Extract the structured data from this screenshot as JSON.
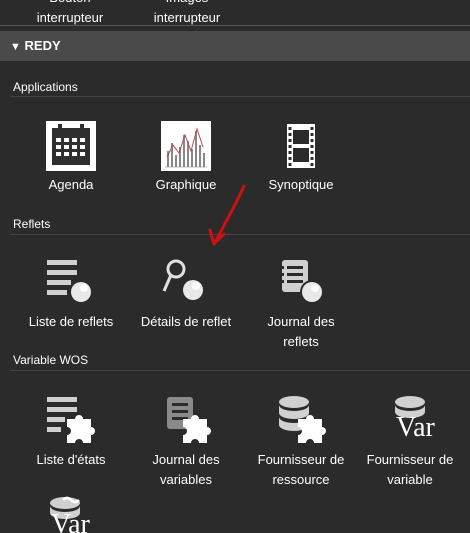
{
  "top_items": [
    {
      "line1": "Bouton",
      "line2": "interrupteur"
    },
    {
      "line1": "Images",
      "line2": "interrupteur"
    }
  ],
  "group": {
    "title": "REDY"
  },
  "sections": {
    "applications": {
      "title": "Applications",
      "items": [
        {
          "label": "Agenda"
        },
        {
          "label": "Graphique"
        },
        {
          "label": "Synoptique"
        }
      ]
    },
    "reflets": {
      "title": "Reflets",
      "items": [
        {
          "line1": "Liste de reflets",
          "line2": ""
        },
        {
          "line1": "Détails de reflet",
          "line2": ""
        },
        {
          "line1": "Journal des",
          "line2": "reflets"
        }
      ]
    },
    "variable_wos": {
      "title": "Variable WOS",
      "items": [
        {
          "line1": "Liste d'états",
          "line2": ""
        },
        {
          "line1": "Journal des",
          "line2": "variables"
        },
        {
          "line1": "Fournisseur de",
          "line2": "ressource"
        },
        {
          "line1": "Fournisseur de",
          "line2": "variable"
        }
      ]
    }
  },
  "icon_text": {
    "var": "Var"
  },
  "colors": {
    "header_bg": "#4a4a4a",
    "page_bg": "#2b2b2b",
    "annotation_arrow": "#d01010"
  }
}
